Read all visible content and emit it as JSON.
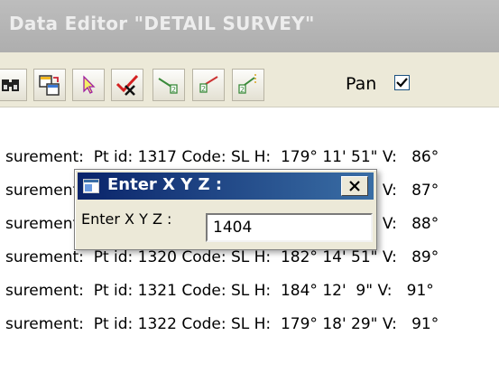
{
  "window": {
    "title": "Data Editor \"DETAIL SURVEY\""
  },
  "toolbar": {
    "buttons": [
      {
        "name": "find-icon"
      },
      {
        "name": "copy-icon"
      },
      {
        "name": "select-arrow-icon"
      },
      {
        "name": "delete-check-icon"
      },
      {
        "name": "line-point-icon"
      },
      {
        "name": "traverse-icon"
      },
      {
        "name": "elevation-icon"
      }
    ],
    "pan_label": "Pan",
    "pan_checked": true
  },
  "rows": [
    "surement:  Pt id: 1317 Code: SL H:  179° 11' 51\" V:   86°",
    "surement:  Pt id: 1318 Code: SL H:  180° 37' 11\" V:   87°",
    "surement:  Pt id: 1319 Code: SL H:  181° 26' 42\" V:   88°",
    "surement:  Pt id: 1320 Code: SL H:  182° 14' 51\" V:   89°",
    "surement:  Pt id: 1321 Code: SL H:  184° 12'  9\" V:   91°",
    "surement:  Pt id: 1322 Code: SL H:  179° 18' 29\" V:   91°"
  ],
  "dialog": {
    "title": "Enter X Y Z :",
    "label": "Enter X Y Z :",
    "input_value": "1404",
    "close_label": "X"
  }
}
